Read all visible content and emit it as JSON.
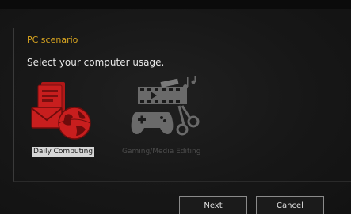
{
  "wizard": {
    "section_title": "PC scenario",
    "instruction": "Select your computer usage."
  },
  "options": [
    {
      "label": "Daily Computing",
      "icon": "daily-computing-icon",
      "selected": true,
      "color": "#c81e1e"
    },
    {
      "label": "Gaming/Media Editing",
      "icon": "gaming-media-icon",
      "selected": false,
      "color": "#6a6a6a"
    }
  ],
  "buttons": {
    "next_label": "Next",
    "cancel_label": "Cancel"
  },
  "colors": {
    "title": "#d9a520",
    "accent_red": "#c81e1e",
    "disabled_grey": "#6a6a6a"
  }
}
